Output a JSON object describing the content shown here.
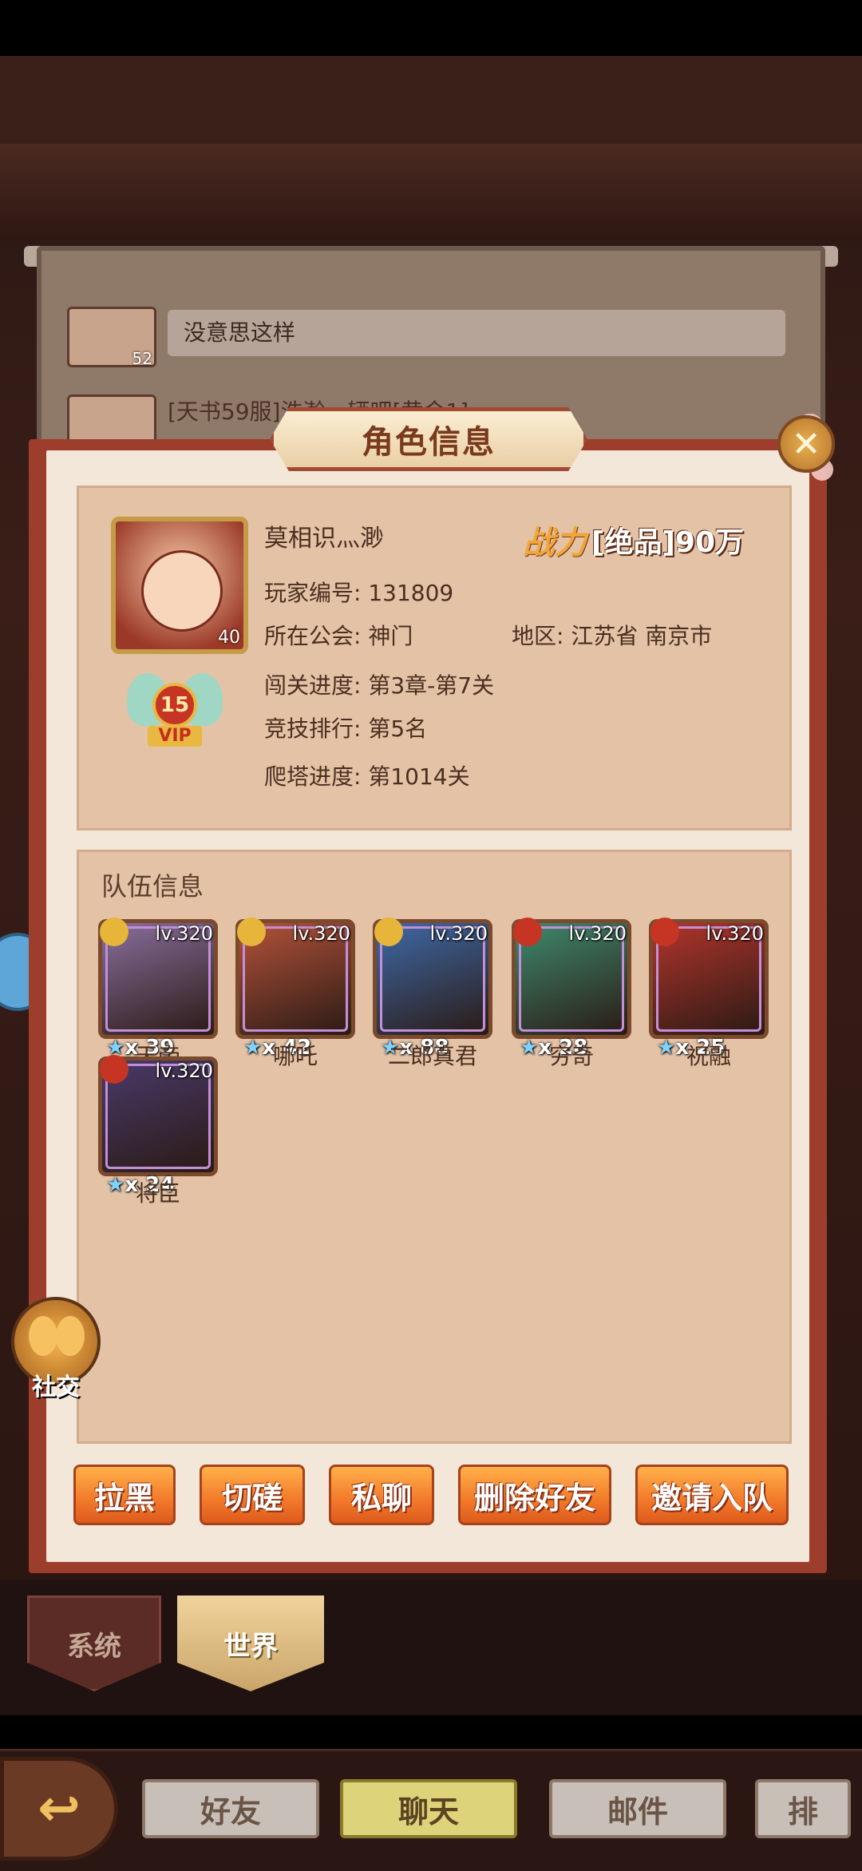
{
  "chat": {
    "messages": [
      {
        "text": "没意思这样",
        "level": "52"
      },
      {
        "text": "[天书59服]浩瀚一辆吧[黄金1]"
      }
    ]
  },
  "dialog": {
    "title": "角色信息",
    "close_icon": "close-icon",
    "player": {
      "name": "莫相识灬渺",
      "avatar_level": "40",
      "vip_level": "15",
      "vip_label": "VIP",
      "power_label": "战力",
      "power_value": "[绝品]90万",
      "id_line": "玩家编号: 131809",
      "guild_line": "所在公会: 神门",
      "region_line": "地区: 江苏省 南京市",
      "stage_line": "闯关进度: 第3章-第7关",
      "arena_line": "竞技排行: 第5名",
      "tower_line": "爬塔进度: 第1014关"
    },
    "team": {
      "title": "队伍信息",
      "heroes": [
        {
          "name": "天帝",
          "level": "lv.320",
          "stars": "x 39",
          "faction_color": "#e6b53a",
          "bg": "#8a6f9e"
        },
        {
          "name": "哪吒",
          "level": "lv.320",
          "stars": "x 42",
          "faction_color": "#e6b53a",
          "bg": "#b4533a"
        },
        {
          "name": "二郎真君",
          "level": "lv.320",
          "stars": "x 88",
          "faction_color": "#e6b53a",
          "bg": "#3f6aa8"
        },
        {
          "name": "穷奇",
          "level": "lv.320",
          "stars": "x 28",
          "faction_color": "#c63524",
          "bg": "#3f8a6e"
        },
        {
          "name": "祝融",
          "level": "lv.320",
          "stars": "x 25",
          "faction_color": "#c63524",
          "bg": "#b2352c"
        },
        {
          "name": "将臣",
          "level": "lv.320",
          "stars": "x 24",
          "faction_color": "#c63524",
          "bg": "#4a3a6a"
        }
      ]
    },
    "buttons": {
      "block": "拉黑",
      "duel": "切磋",
      "private_chat": "私聊",
      "delete_friend": "删除好友",
      "invite_team": "邀请入队"
    }
  },
  "social": {
    "label": "社交"
  },
  "channel_tabs": {
    "system": "系统",
    "world": "世界"
  },
  "nav": {
    "friends": "好友",
    "chat": "聊天",
    "mail": "邮件",
    "rank": "排"
  }
}
